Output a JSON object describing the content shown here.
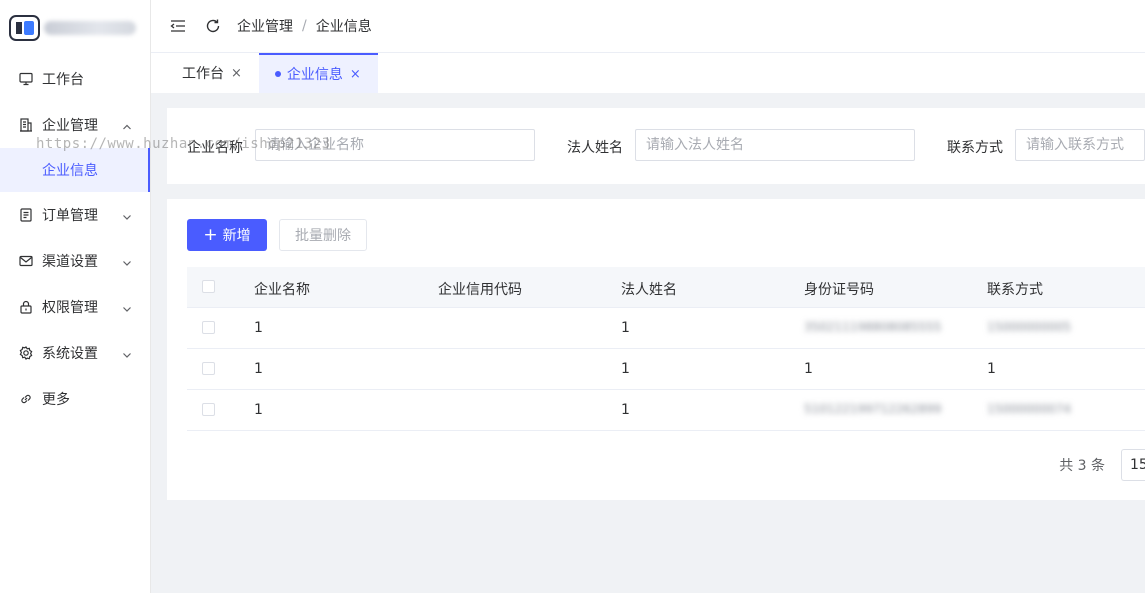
{
  "app": {
    "name_blurred": ""
  },
  "sidebar": {
    "items": [
      {
        "label": "工作台",
        "icon": "monitor-icon"
      },
      {
        "label": "企业管理",
        "icon": "building-icon",
        "open": true,
        "children": [
          {
            "label": "企业信息",
            "active": true
          }
        ]
      },
      {
        "label": "订单管理",
        "icon": "document-icon"
      },
      {
        "label": "渠道设置",
        "icon": "mail-icon"
      },
      {
        "label": "权限管理",
        "icon": "lock-icon"
      },
      {
        "label": "系统设置",
        "icon": "gear-icon"
      },
      {
        "label": "更多",
        "icon": "link-icon"
      }
    ]
  },
  "header": {
    "breadcrumb": [
      "企业管理",
      "企业信息"
    ],
    "separator": "/"
  },
  "tabs": [
    {
      "label": "工作台",
      "close": "×",
      "active": false
    },
    {
      "label": "企业信息",
      "close": "×",
      "active": true
    }
  ],
  "search": {
    "company_name": {
      "label": "企业名称",
      "placeholder": "请输入企业名称"
    },
    "legal_person": {
      "label": "法人姓名",
      "placeholder": "请输入法人姓名"
    },
    "contact": {
      "label": "联系方式",
      "placeholder": "请输入联系方式"
    }
  },
  "watermark": "https://www.huzhan.com/ishop21323",
  "toolbar": {
    "add_label": "新增",
    "add_icon": "+",
    "batch_delete_label": "批量删除"
  },
  "table": {
    "columns": [
      "企业名称",
      "企业信用代码",
      "法人姓名",
      "身份证号码",
      "联系方式"
    ],
    "rows": [
      [
        "1",
        "",
        "1",
        "350211198808085555",
        "15000000005"
      ],
      [
        "1",
        "",
        "1",
        "1",
        "1"
      ],
      [
        "1",
        "",
        "1",
        "510122199712262899",
        "15000000074"
      ]
    ]
  },
  "pagination": {
    "total_text": "共 3 条",
    "page_size": "15"
  },
  "colors": {
    "primary": "#4a5cff",
    "active_bg": "#eef1ff"
  }
}
